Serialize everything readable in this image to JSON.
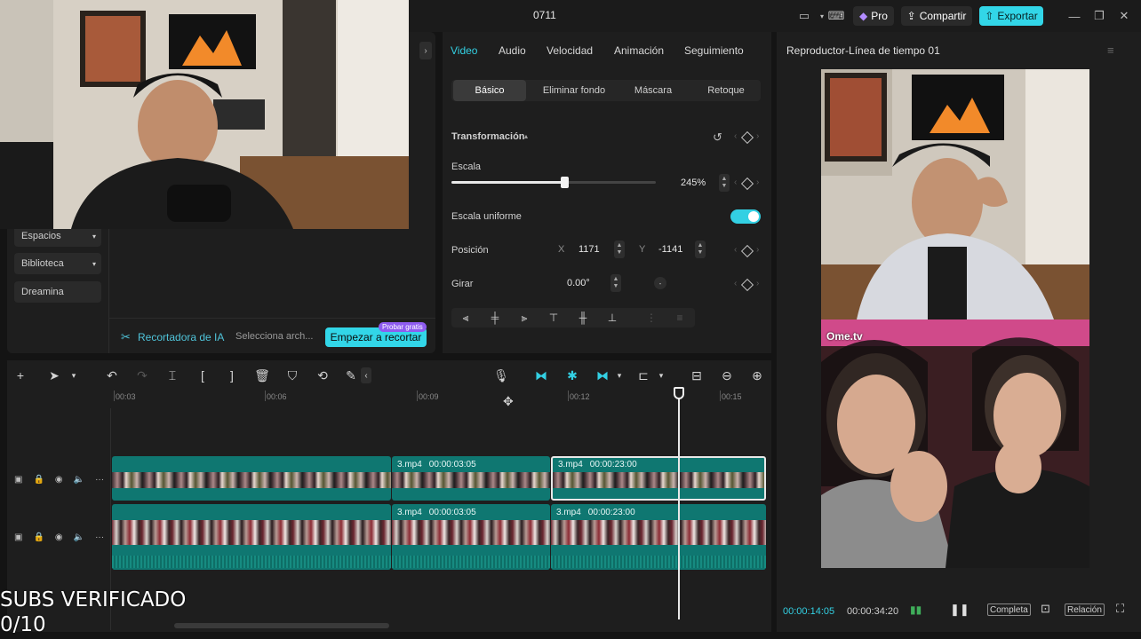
{
  "window": {
    "title": "0711",
    "pro_label": "Pro",
    "share_label": "Compartir",
    "export_label": "Exportar"
  },
  "left_panel": {
    "sidebar": [
      {
        "label": "Espacios"
      },
      {
        "label": "Biblioteca"
      },
      {
        "label": "Dreamina"
      }
    ],
    "ia_label": "Recortadora de IA",
    "ia_file_placeholder": "Selecciona arch...",
    "ia_button": "Empezar a recortar",
    "ia_badge": "Probar gratis"
  },
  "properties": {
    "tabs": [
      "Video",
      "Audio",
      "Velocidad",
      "Animación",
      "Seguimiento"
    ],
    "active_tab": "Video",
    "subtabs": [
      "Básico",
      "Eliminar fondo",
      "Máscara",
      "Retoque"
    ],
    "active_subtab": "Básico",
    "section_title": "Transformación",
    "scale_label": "Escala",
    "scale_value": "245%",
    "scale_fraction": 0.55,
    "uniform_label": "Escala uniforme",
    "uniform_on": true,
    "position_label": "Posición",
    "pos_x_label": "X",
    "pos_x": "1171",
    "pos_y_label": "Y",
    "pos_y": "-1141",
    "rotate_label": "Girar",
    "rotate_value": "0.00°"
  },
  "player": {
    "title": "Reproductor-Línea de tiempo 01",
    "overlay_text": "Ome.tv",
    "current_time": "00:00:14:05",
    "total_time": "00:00:34:20",
    "full_label": "Completa",
    "ratio_label": "Relación"
  },
  "timeline": {
    "ruler": [
      "00:03",
      "00:06",
      "00:09",
      "00:12",
      "00:15"
    ],
    "tracks": [
      {
        "clips": [
          {
            "name": "",
            "duration": ""
          },
          {
            "name": "3.mp4",
            "duration": "00:00:03:05"
          },
          {
            "name": "3.mp4",
            "duration": "00:00:23:00"
          }
        ]
      },
      {
        "clips": [
          {
            "name": "",
            "duration": ""
          },
          {
            "name": "3.mp4",
            "duration": "00:00:03:05"
          },
          {
            "name": "3.mp4",
            "duration": "00:00:23:00"
          }
        ]
      }
    ]
  },
  "overlay": {
    "subs_line1": "SUBS VERIFICADO",
    "subs_line2": "0/10"
  },
  "colors": {
    "accent": "#33d0e3",
    "clip": "#0f7771",
    "badge": "#8e5cf0"
  }
}
